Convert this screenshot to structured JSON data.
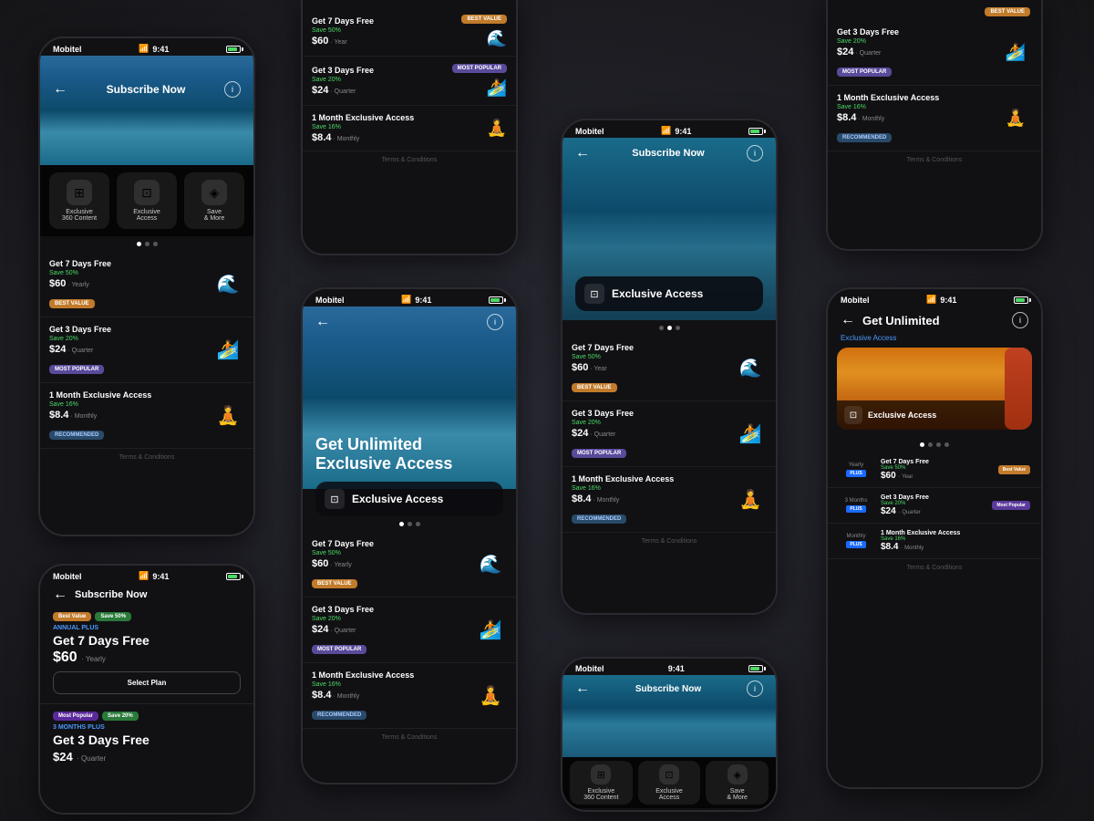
{
  "app": {
    "title": "Subscribe Now",
    "background": "#1a1a1f"
  },
  "plans": [
    {
      "id": "yearly",
      "title": "Get 7 Days Free",
      "save": "Save 50%",
      "price": "$60",
      "period": "Year",
      "badge": "Best Value",
      "badge_type": "best"
    },
    {
      "id": "quarterly",
      "title": "Get 3 Days Free",
      "save": "Save 20%",
      "price": "$24",
      "period": "Quarter",
      "badge": "Most Popular",
      "badge_type": "popular"
    },
    {
      "id": "monthly",
      "title": "1 Month Exclusive Access",
      "save": "Save 16%",
      "price": "$8.4",
      "period": "Monthly",
      "badge": "Recommended",
      "badge_type": "recommended"
    }
  ],
  "features": [
    {
      "label": "Exclusive\n360 Content",
      "icon": "⊞"
    },
    {
      "label": "Exclusive\nAccess",
      "icon": "⊡"
    },
    {
      "label": "Save\n& More",
      "icon": "◈"
    }
  ],
  "nav": {
    "back": "←",
    "title": "Subscribe Now",
    "info": "i"
  },
  "get_unlimited": {
    "title": "Get Unlimited\nExclusive Access",
    "subtitle": "Exclusive Access",
    "back": "←"
  },
  "terms": "Terms & Conditions",
  "annual_plus": "ANNUAL PLUS",
  "months_plus": "3 MONTHS PLUS",
  "select_plan": "Select Plan",
  "dots": [
    true,
    false,
    false
  ],
  "dots2": [
    false,
    true,
    false
  ],
  "dots3": [
    false,
    true,
    false,
    false
  ]
}
